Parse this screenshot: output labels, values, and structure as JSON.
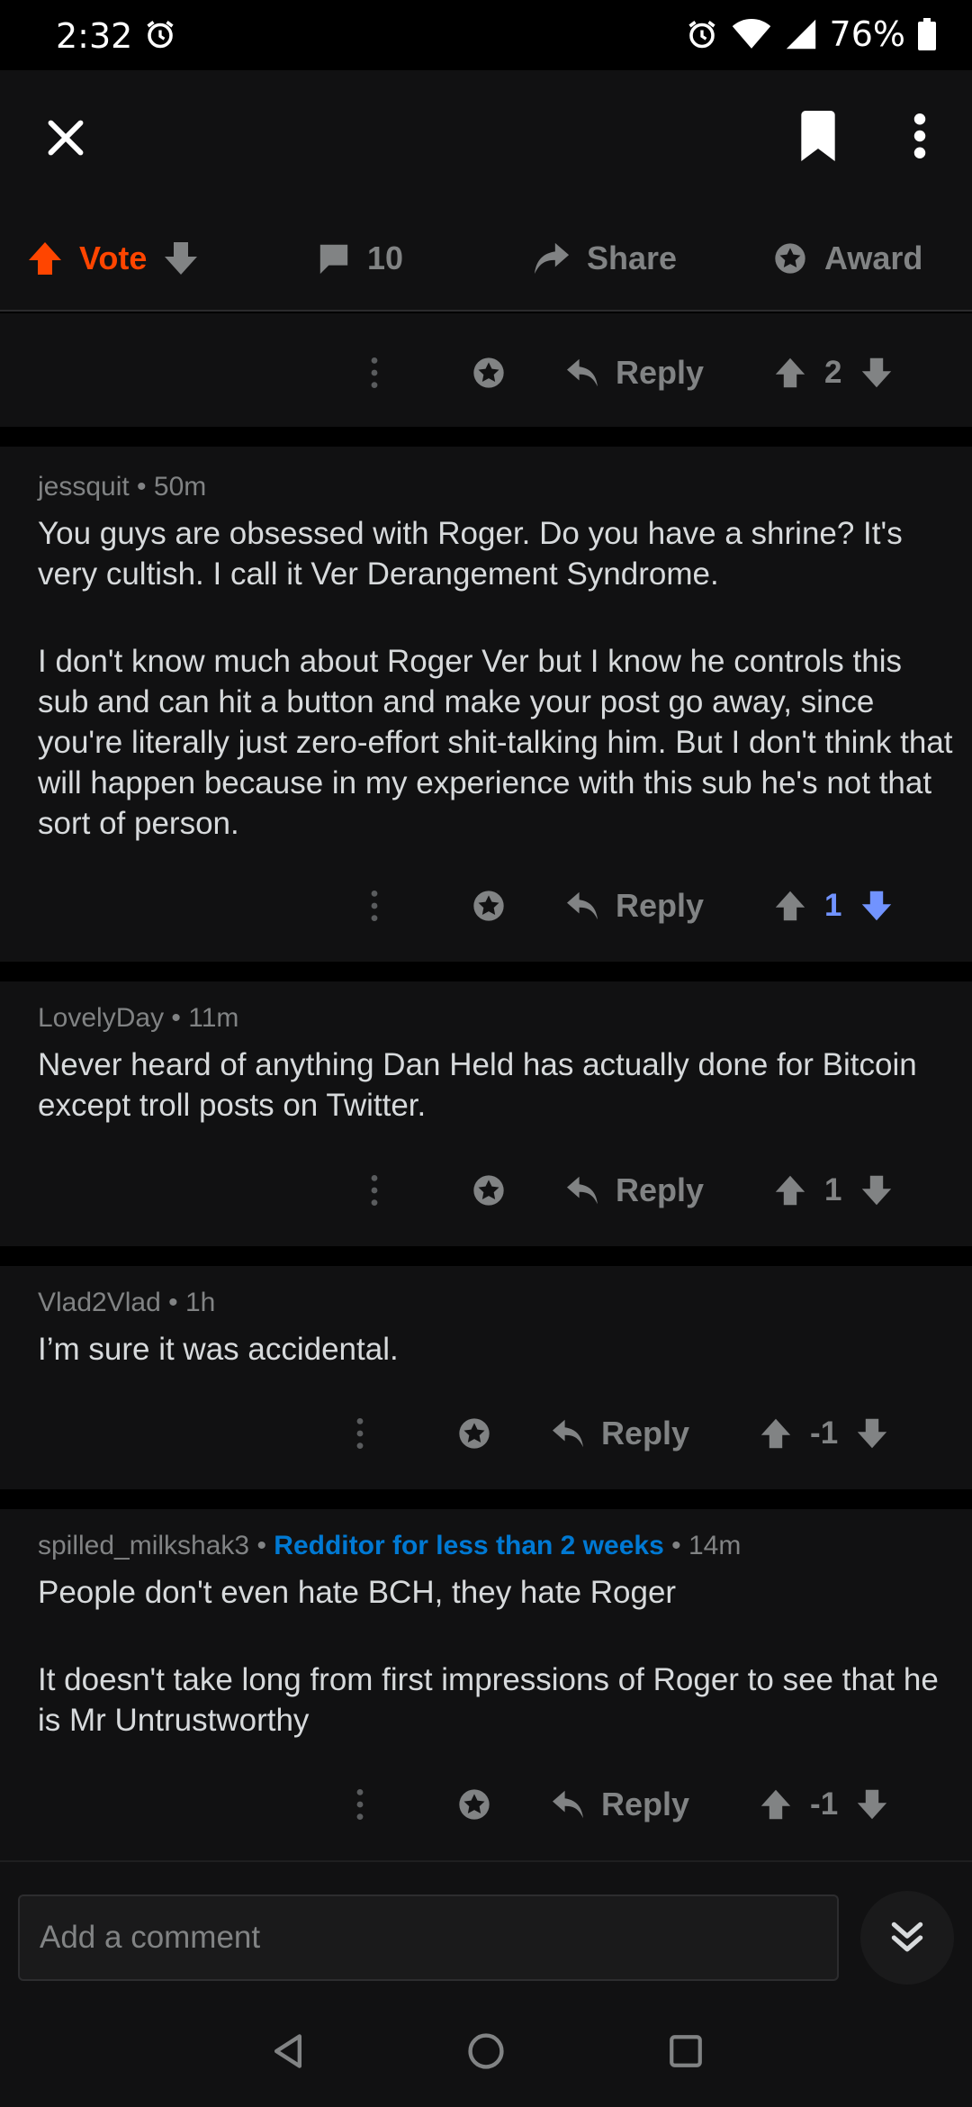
{
  "status_bar": {
    "time": "2:32",
    "battery": "76%"
  },
  "app_bar": {},
  "action_bar": {
    "vote_label": "Vote",
    "comment_count": "10",
    "share_label": "Share",
    "award_label": "Award"
  },
  "colors": {
    "accent": "#ff4500",
    "downvote": "#7193ff",
    "flair": "#0079d3",
    "surface": "#111112"
  },
  "comments": [
    {
      "reply_label": "Reply",
      "score": "2"
    },
    {
      "author": "jessquit",
      "age": "50m",
      "paragraphs": [
        "You guys are obsessed with Roger. Do you have a shrine? It's very cultish. I call it Ver Derangement Syndrome.",
        "I don't know much about Roger Ver but I know he controls this sub and can hit a button and make your post go away, since you're literally just zero-effort shit-talking him. But I don't think that will happen because in my experience with this sub he's not that sort of person."
      ],
      "reply_label": "Reply",
      "score": "1"
    },
    {
      "author": "LovelyDay",
      "age": "11m",
      "paragraphs": [
        "Never heard of anything Dan Held has actually done for Bitcoin except troll posts on Twitter."
      ],
      "reply_label": "Reply",
      "score": "1"
    },
    {
      "author": "Vlad2Vlad",
      "age": "1h",
      "paragraphs": [
        "I’m sure it was accidental."
      ],
      "reply_label": "Reply",
      "score": "-1"
    },
    {
      "author": "spilled_milkshak3",
      "flair": "Redditor for less than 2 weeks",
      "age": "14m",
      "paragraphs": [
        "People don't even hate BCH, they hate Roger",
        "It doesn't take long from first impressions of Roger to see that he is Mr Untrustworthy"
      ],
      "reply_label": "Reply",
      "score": "-1"
    }
  ],
  "comment_input": {
    "placeholder": "Add a comment"
  }
}
